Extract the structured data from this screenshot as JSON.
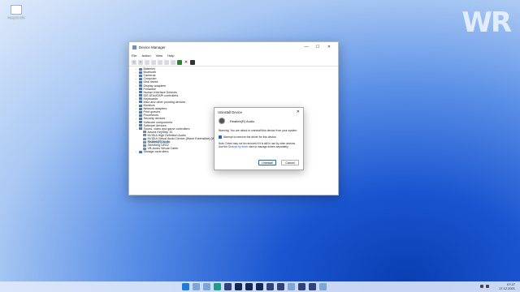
{
  "desktop": {
    "recycle_bin_label": "Recycle Bin",
    "brand_logo": "WR"
  },
  "window": {
    "title": "Device Manager",
    "controls": {
      "minimize": "—",
      "maximize": "☐",
      "close": "✕"
    },
    "menu": [
      "File",
      "Action",
      "View",
      "Help"
    ],
    "tree": [
      {
        "label": "Batteries",
        "child": false
      },
      {
        "label": "Bluetooth",
        "child": false
      },
      {
        "label": "Cameras",
        "child": false
      },
      {
        "label": "Computer",
        "child": false
      },
      {
        "label": "Disk drives",
        "child": false
      },
      {
        "label": "Display adapters",
        "child": false
      },
      {
        "label": "Firmware",
        "child": false
      },
      {
        "label": "Human Interface Devices",
        "child": false
      },
      {
        "label": "IDE ATA/ATAPI controllers",
        "child": false
      },
      {
        "label": "Keyboards",
        "child": false
      },
      {
        "label": "Mice and other pointing devices",
        "child": false
      },
      {
        "label": "Monitors",
        "child": false
      },
      {
        "label": "Network adapters",
        "child": false
      },
      {
        "label": "Print queues",
        "child": false
      },
      {
        "label": "Processors",
        "child": false
      },
      {
        "label": "Security devices",
        "child": false
      },
      {
        "label": "Software components",
        "child": false
      },
      {
        "label": "Software devices",
        "child": false
      },
      {
        "label": "Sound, video and game controllers",
        "child": false,
        "expanded": true
      },
      {
        "label": "Arturia KeyStep 32",
        "child": true
      },
      {
        "label": "NVIDIA High Definition Audio",
        "child": true
      },
      {
        "label": "NVIDIA Virtual Audio Device (Wave Extensible) (WDM)",
        "child": true
      },
      {
        "label": "Realtek(R) Audio",
        "child": true,
        "selected": true
      },
      {
        "label": "Steinberg UR22",
        "child": true
      },
      {
        "label": "VB-Audio Virtual Cable",
        "child": true
      },
      {
        "label": "Storage controllers",
        "child": false
      }
    ]
  },
  "dialog": {
    "title": "Uninstall Device",
    "close": "✕",
    "device_name": "Realtek(R) Audio",
    "warning": "Warning: You are about to uninstall this device from your system.",
    "checkbox_label": "Attempt to remove the driver for this device.",
    "note_before": "Note: Driver may not be removed if it is still in use by other devices. Use the ",
    "note_link": "Devices by driver",
    "note_after": " view to manage drivers separately.",
    "uninstall_label": "Uninstall",
    "cancel_label": "Cancel"
  },
  "taskbar": {
    "time": "07:27",
    "date": "17.12.2021"
  },
  "colors": {
    "accent": "#1a66cc",
    "selection": "#cce4f7",
    "uninstall_icon": "#c62828"
  }
}
